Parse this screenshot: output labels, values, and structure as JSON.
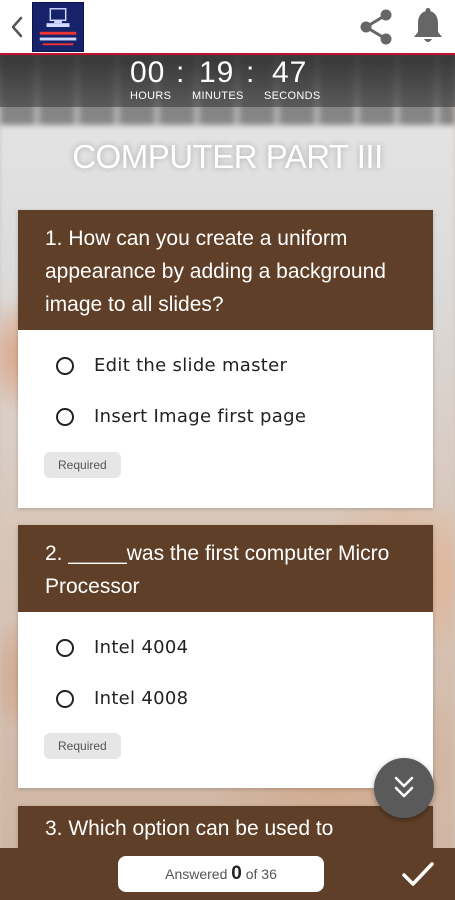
{
  "header": {
    "logo_icon": "computer-logo-icon",
    "logo_text": "COMPUTER",
    "back_icon": "chevron-left-icon",
    "share_icon": "share-icon",
    "bell_icon": "bell-icon"
  },
  "timer": {
    "hours": "00",
    "minutes": "19",
    "seconds": "47",
    "sep": ":",
    "hours_label": "HOURS",
    "minutes_label": "MINUTES",
    "seconds_label": "SECONDS"
  },
  "quiz": {
    "title": "COMPUTER PART III"
  },
  "questions": [
    {
      "text": "1. How can you create a uniform appearance by adding a background image to all slides?",
      "options": [
        "Edit the slide master",
        "Insert Image first page"
      ],
      "required_label": "Required"
    },
    {
      "text": "2. _____was the first computer Micro Processor",
      "options": [
        "Intel 4004",
        "Intel 4008"
      ],
      "required_label": "Required"
    },
    {
      "text": "3. Which option can be used to"
    }
  ],
  "scroll_button_icon": "double-chevron-down-icon",
  "footer": {
    "answered_prefix": "Answered",
    "answered_count": "0",
    "answered_suffix": "of 36",
    "submit_icon": "checkmark-icon"
  },
  "colors": {
    "brand_brown": "#5f3f27",
    "accent_red": "#c8102e",
    "logo_blue": "#16226a"
  }
}
